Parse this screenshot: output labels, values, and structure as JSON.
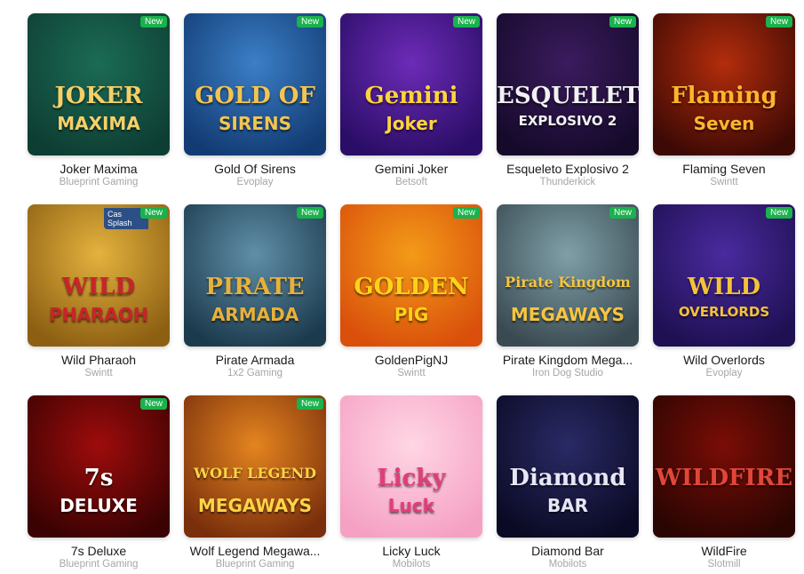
{
  "badge_new": "New",
  "games": [
    {
      "name": "Joker Maxima",
      "provider": "Blueprint Gaming",
      "is_new": true,
      "art_line1": "JOKER",
      "art_line2": "MAXIMA",
      "bg1": "#1b6b55",
      "bg2": "#0e3e33",
      "fg": "#f4d06a"
    },
    {
      "name": "Gold Of Sirens",
      "provider": "Evoplay",
      "is_new": true,
      "art_line1": "GOLD OF",
      "art_line2": "SIRENS",
      "bg1": "#3b7fc7",
      "bg2": "#123b73",
      "fg": "#f2c552"
    },
    {
      "name": "Gemini Joker",
      "provider": "Betsoft",
      "is_new": true,
      "art_line1": "Gemini",
      "art_line2": "Joker",
      "bg1": "#6d2bb8",
      "bg2": "#2a0d66",
      "fg": "#ffd43b"
    },
    {
      "name": "Esqueleto Explosivo 2",
      "provider": "Thunderkick",
      "is_new": true,
      "art_line1": "ESQUELETO",
      "art_line2": "EXPLOSIVO 2",
      "bg1": "#3b1b5e",
      "bg2": "#150a2a",
      "fg": "#f2f2f2"
    },
    {
      "name": "Flaming Seven",
      "provider": "Swintt",
      "is_new": true,
      "art_line1": "Flaming",
      "art_line2": "Seven",
      "bg1": "#b32d0c",
      "bg2": "#3d0904",
      "fg": "#ffb52e"
    },
    {
      "name": "Wild Pharaoh",
      "provider": "Swintt",
      "is_new": true,
      "corner": "Cas Splash",
      "art_line1": "WILD",
      "art_line2": "PHARAOH",
      "bg1": "#e4b23e",
      "bg2": "#8c5f12",
      "fg": "#c8242a"
    },
    {
      "name": "Pirate Armada",
      "provider": "1x2 Gaming",
      "is_new": true,
      "art_line1": "PIRATE",
      "art_line2": "ARMADA",
      "bg1": "#5f8fa8",
      "bg2": "#1c3a4d",
      "fg": "#e8b13a"
    },
    {
      "name": "GoldenPigNJ",
      "provider": "Swintt",
      "is_new": true,
      "art_line1": "GOLDEN",
      "art_line2": "PIG",
      "bg1": "#f39b18",
      "bg2": "#d94f0b",
      "fg": "#ffd21a"
    },
    {
      "name": "Pirate Kingdom Mega...",
      "provider": "Iron Dog Studio",
      "is_new": true,
      "art_line1": "Pirate Kingdom",
      "art_line2": "MEGAWAYS",
      "bg1": "#7fa0a8",
      "bg2": "#3a4a52",
      "fg": "#f5c542"
    },
    {
      "name": "Wild Overlords",
      "provider": "Evoplay",
      "is_new": true,
      "art_line1": "WILD",
      "art_line2": "OVERLORDS",
      "bg1": "#4a2a9e",
      "bg2": "#1e1052",
      "fg": "#f4c23a"
    },
    {
      "name": "7s Deluxe",
      "provider": "Blueprint Gaming",
      "is_new": true,
      "art_line1": "7s",
      "art_line2": "DELUXE",
      "bg1": "#9e0c0c",
      "bg2": "#3a0202",
      "fg": "#ffffff"
    },
    {
      "name": "Wolf Legend Megawa...",
      "provider": "Blueprint Gaming",
      "is_new": true,
      "art_line1": "WOLF LEGEND",
      "art_line2": "MEGAWAYS",
      "bg1": "#e4851f",
      "bg2": "#7a2f0c",
      "fg": "#ffd447"
    },
    {
      "name": "Licky Luck",
      "provider": "Mobilots",
      "is_new": false,
      "art_line1": "Licky",
      "art_line2": "Luck",
      "bg1": "#ffd6e4",
      "bg2": "#f5a1c4",
      "fg": "#e23d7a"
    },
    {
      "name": "Diamond Bar",
      "provider": "Mobilots",
      "is_new": false,
      "art_line1": "Diamond",
      "art_line2": "BAR",
      "bg1": "#2a2a66",
      "bg2": "#0a0a24",
      "fg": "#e6e6f5"
    },
    {
      "name": "WildFire",
      "provider": "Slotmill",
      "is_new": false,
      "art_line1": "WILDFIRE",
      "art_line2": "",
      "bg1": "#7a0d06",
      "bg2": "#2a0502",
      "fg": "#e0473a"
    }
  ]
}
